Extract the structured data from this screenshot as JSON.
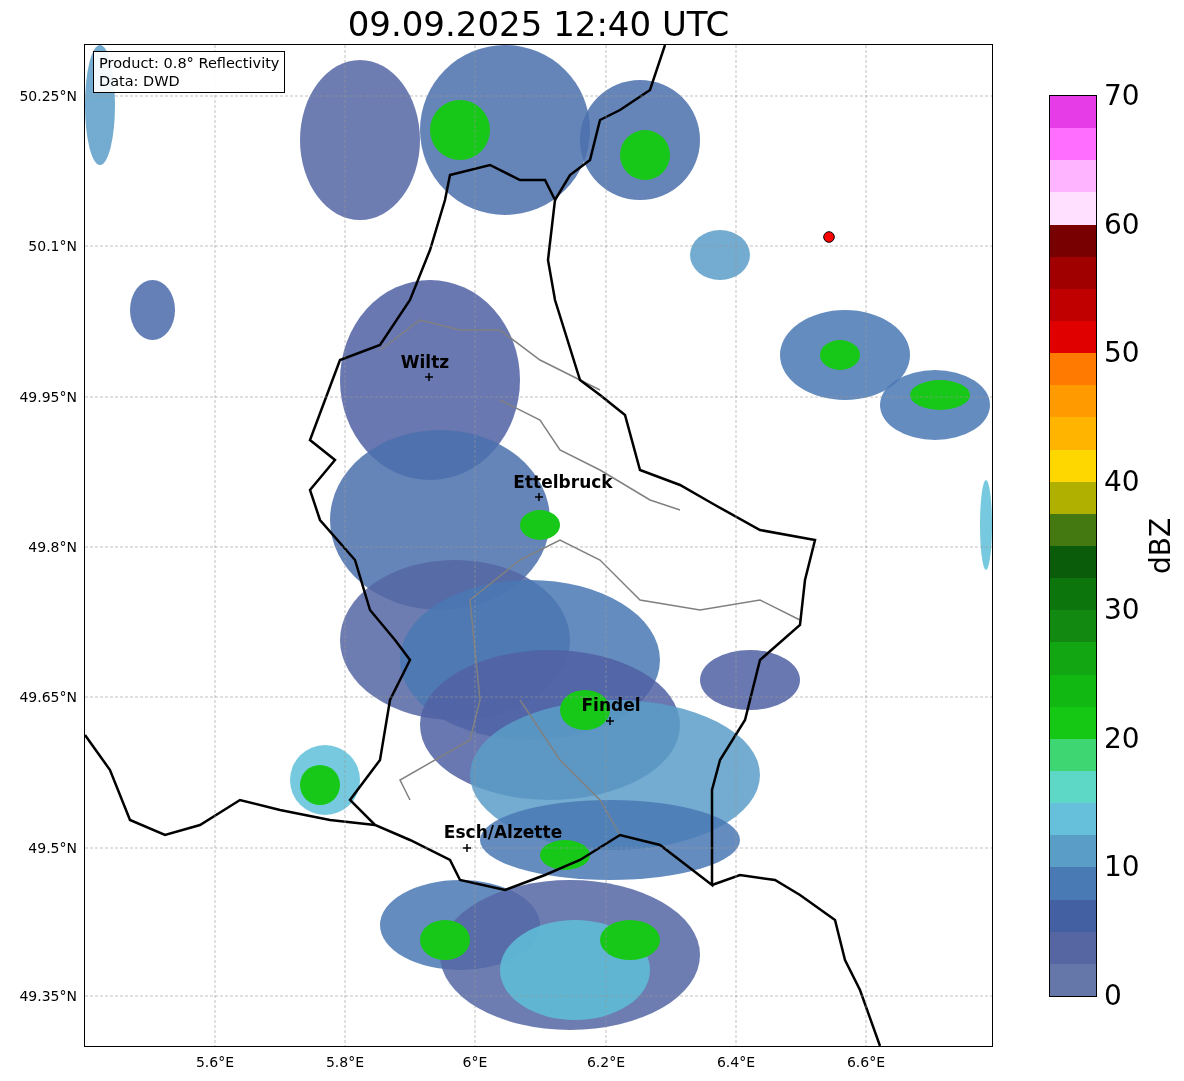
{
  "title": "09.09.2025 12:40 UTC",
  "info_box": [
    "Product: 0.8° Reflectivity",
    "Data: DWD"
  ],
  "lat_labels": [
    "50.25°N",
    "50.1°N",
    "49.95°N",
    "49.8°N",
    "49.65°N",
    "49.5°N",
    "49.35°N"
  ],
  "lon_labels": [
    "5.6°E",
    "5.8°E",
    "6°E",
    "6.2°E",
    "6.4°E",
    "6.6°E"
  ],
  "cities": [
    {
      "name": "Wiltz"
    },
    {
      "name": "Ettelbruck"
    },
    {
      "name": "Findel"
    },
    {
      "name": "Esch/Alzette"
    }
  ],
  "colorbar": {
    "label": "dBZ",
    "ticks": [
      "70",
      "60",
      "50",
      "40",
      "30",
      "20",
      "10",
      "0"
    ],
    "segments": [
      {
        "color": "#e63ce8"
      },
      {
        "color": "#ff6eff"
      },
      {
        "color": "#ffb4ff"
      },
      {
        "color": "#ffe0ff"
      },
      {
        "color": "#780000"
      },
      {
        "color": "#a00000"
      },
      {
        "color": "#c00000"
      },
      {
        "color": "#e00000"
      },
      {
        "color": "#ff7a00"
      },
      {
        "color": "#ff9a00"
      },
      {
        "color": "#ffb400"
      },
      {
        "color": "#ffd700"
      },
      {
        "color": "#b0b000"
      },
      {
        "color": "#447810"
      },
      {
        "color": "#0a5c0a"
      },
      {
        "color": "#0c760c"
      },
      {
        "color": "#128a12"
      },
      {
        "color": "#12a612"
      },
      {
        "color": "#12b812"
      },
      {
        "color": "#14c814"
      },
      {
        "color": "#3ed672"
      },
      {
        "color": "#5ed8c6"
      },
      {
        "color": "#66c0dc"
      },
      {
        "color": "#5a9ec8"
      },
      {
        "color": "#4a7ab4"
      },
      {
        "color": "#4360a3"
      },
      {
        "color": "#5566a3"
      },
      {
        "color": "#6577a8"
      }
    ]
  }
}
